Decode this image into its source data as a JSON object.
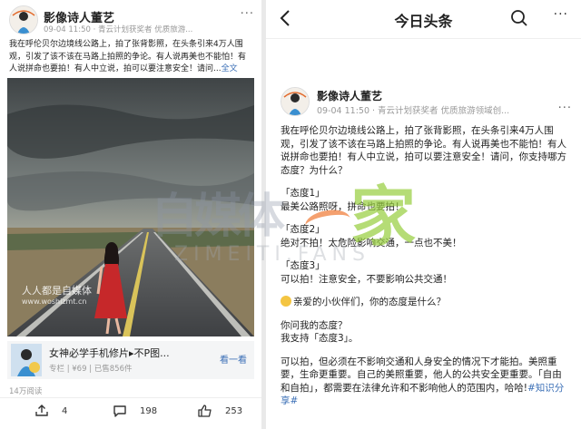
{
  "left": {
    "author": "影像诗人董艺",
    "meta": "09-04 11:50 · 青云计划获奖者 优质旅游...",
    "more_icon": "more-dots-icon",
    "body_text": "我在呼伦贝尔边境线公路上，拍了张背影照，在头条引来4万人围观，引发了该不该在马路上拍照的争论。有人说再美也不能怕！有人说拼命也要拍！有人中立说，拍可以要注意安全！请问...",
    "body_more": "全文",
    "watermark_small": "人人都是自媒体",
    "watermark_url": "www.woshizmt.cn",
    "app_card": {
      "title": "女神必学手机修片▸不P图...",
      "sub": "专栏 | ¥69 | 已售856件",
      "button": "看一看"
    },
    "reads": "14万阅读",
    "actions": {
      "share_count": "4",
      "comment_count": "198",
      "like_count": "253"
    }
  },
  "right": {
    "nav_title": "今日头条",
    "author": "影像诗人董艺",
    "meta": "09-04 11:50 · 青云计划获奖者 优质旅游领域创...",
    "paragraphs": [
      "我在呼伦贝尔边境线公路上，拍了张背影照，在头条引来4万人围观，引发了该不该在马路上拍照的争论。有人说再美也不能怕！有人说拼命也要拍！有人中立说，拍可以要注意安全！请问，你支持哪方态度？为什么？",
      "「态度1」",
      "最美公路照呀，拼命也要拍！",
      "「态度2」",
      "绝对不拍！太危险影响交通，一点也不美！",
      "「态度3」",
      "可以拍！注意安全，不要影响公共交通！",
      "亲爱的小伙伴们，你的态度是什么？",
      "你问我的态度？",
      "我支持「态度3」。",
      "可以拍，但必须在不影响交通和人身安全的情况下才能拍。美照重要，生命更重要。自己的美照重要，他人的公共安全更重要。「自由和自拍」，都需要在法律允许和不影响他人的范围内，哈哈!",
      "#知识分享#"
    ]
  },
  "watermark": {
    "big": "自媒体",
    "home": "家",
    "fans": "ZIMEITI.FANS"
  },
  "colors": {
    "link": "#3b6fb6",
    "meta": "#999999",
    "watermark_green": "#96cd3c",
    "watermark_orange": "#f07832"
  }
}
